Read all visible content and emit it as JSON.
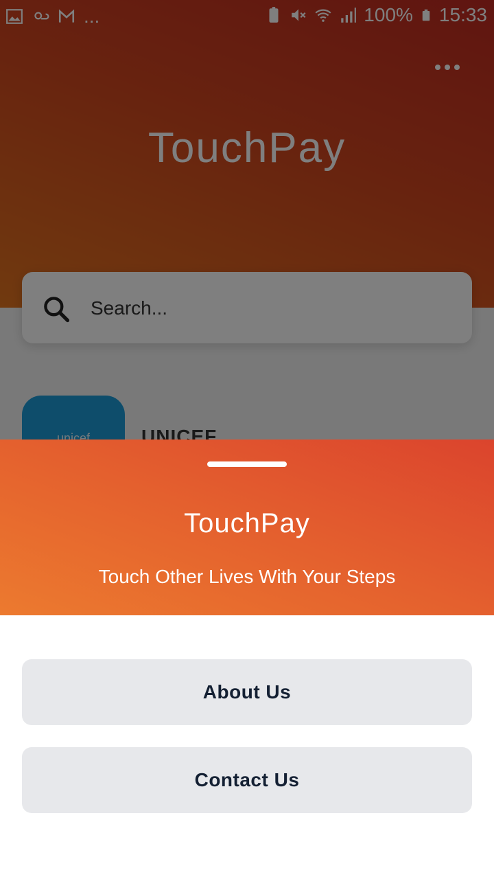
{
  "status_bar": {
    "left_icons": [
      "image-icon",
      "weather-icon",
      "gmail-icon"
    ],
    "overflow": "...",
    "battery_percent": "100%",
    "time": "15:33",
    "right_icons": [
      "battery-saver-icon",
      "mute-icon",
      "wifi-icon",
      "signal-icon",
      "battery-icon"
    ]
  },
  "header": {
    "logo": "TouchPay",
    "menu_icon": "more-horizontal-icon"
  },
  "search": {
    "placeholder": "Search...",
    "icon": "search-icon"
  },
  "organizations": [
    {
      "name": "UNICEF",
      "logo_text": "unicef"
    }
  ],
  "sheet": {
    "logo": "TouchPay",
    "tagline": "Touch Other Lives With Your Steps",
    "buttons": {
      "about": "About Us",
      "contact": "Contact Us"
    }
  },
  "colors": {
    "brand_orange": "#e4602e",
    "brand_red": "#db442d",
    "unicef_blue": "#1c9ad6",
    "button_bg": "#e7e8eb",
    "button_text": "#142033"
  }
}
